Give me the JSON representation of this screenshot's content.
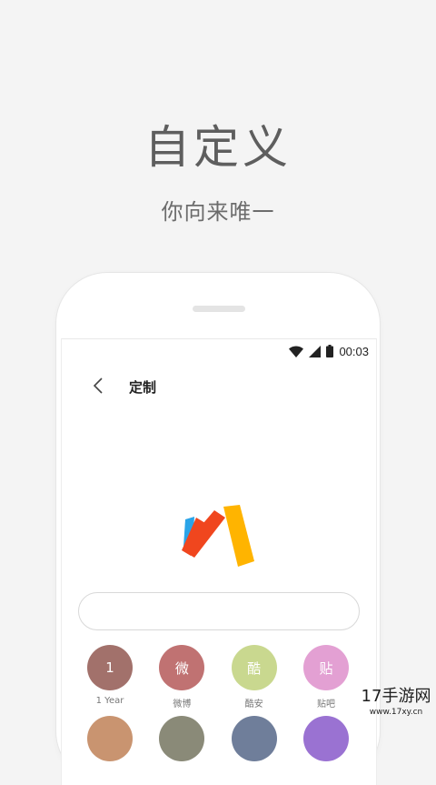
{
  "promo": {
    "headline": "自定义",
    "subline": "你向来唯一"
  },
  "status_bar": {
    "icons": [
      "wifi-icon",
      "cell-signal-icon",
      "battery-icon"
    ],
    "time": "00:03"
  },
  "app_bar": {
    "back_icon": "chevron-left-icon",
    "title": "定制"
  },
  "logo": {
    "name": "via-logo",
    "colors": [
      "#2aa4e8",
      "#f0461e",
      "#ffb400"
    ]
  },
  "url_bar": {
    "value": ""
  },
  "shortcuts": [
    {
      "glyph": "1",
      "label": "1 Year",
      "color": "#a2716b"
    },
    {
      "glyph": "微",
      "label": "微博",
      "color": "#c07272"
    },
    {
      "glyph": "酷",
      "label": "酷安",
      "color": "#c9d88f"
    },
    {
      "glyph": "贴",
      "label": "贴吧",
      "color": "#e3a0d3"
    }
  ],
  "shortcuts_row2_colors": [
    "#c99470",
    "#8a8a78",
    "#6f7e9a",
    "#9a72d2"
  ],
  "watermark": {
    "main": "17手游网",
    "url": "www.17xy.cn"
  }
}
